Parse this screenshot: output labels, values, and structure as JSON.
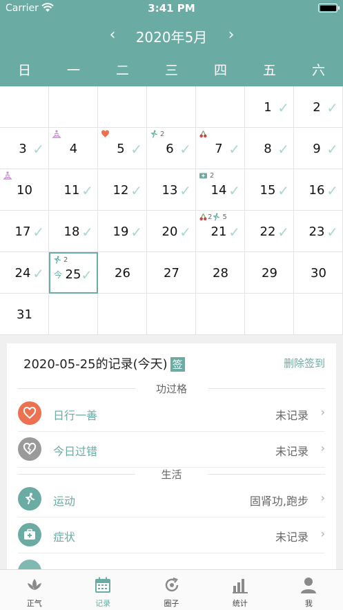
{
  "status_bar": {
    "carrier": "Carrier",
    "time": "3:41 PM"
  },
  "header": {
    "month_title": "2020年5月",
    "prev": "‹",
    "next": "›"
  },
  "weekdays": [
    "日",
    "一",
    "二",
    "三",
    "四",
    "五",
    "六"
  ],
  "calendar": {
    "days": [
      {
        "d": "1",
        "check": true
      },
      {
        "d": "2",
        "check": true
      },
      {
        "d": "3",
        "check": true
      },
      {
        "d": "4",
        "check": false,
        "icon": "meditation-icon"
      },
      {
        "d": "5",
        "check": true,
        "icon": "heart-icon"
      },
      {
        "d": "6",
        "check": true,
        "icon": "run-icon",
        "count": "2"
      },
      {
        "d": "7",
        "check": true,
        "icon": "cherry-icon"
      },
      {
        "d": "8",
        "check": true
      },
      {
        "d": "9",
        "check": true
      },
      {
        "d": "10",
        "check": false,
        "icon": "meditation-icon"
      },
      {
        "d": "11",
        "check": true
      },
      {
        "d": "12",
        "check": true
      },
      {
        "d": "13",
        "check": true
      },
      {
        "d": "14",
        "check": true,
        "icon": "medkit-icon",
        "count": "2"
      },
      {
        "d": "15",
        "check": true
      },
      {
        "d": "16",
        "check": true
      },
      {
        "d": "17",
        "check": true
      },
      {
        "d": "18",
        "check": true
      },
      {
        "d": "19",
        "check": true
      },
      {
        "d": "20",
        "check": true
      },
      {
        "d": "21",
        "check": true,
        "icon": "cherry-run-icon",
        "count": "2",
        "count2": "5"
      },
      {
        "d": "22",
        "check": true
      },
      {
        "d": "23",
        "check": true
      },
      {
        "d": "24",
        "check": true
      },
      {
        "d": "25",
        "check": true,
        "icon": "run-icon",
        "count": "2",
        "today": true,
        "today_tag": "今"
      },
      {
        "d": "26",
        "check": false
      },
      {
        "d": "27",
        "check": false
      },
      {
        "d": "28",
        "check": false
      },
      {
        "d": "29",
        "check": false
      },
      {
        "d": "30",
        "check": false
      },
      {
        "d": "31",
        "check": false
      }
    ],
    "first_weekday": 5
  },
  "panel": {
    "title": "2020-05-25的记录(今天)",
    "sign_badge": "签",
    "delete_label": "删除签到",
    "section_merit": "功过格",
    "section_life": "生活",
    "rows": [
      {
        "title": "日行一善",
        "value": "未记录",
        "color": "#ec7150"
      },
      {
        "title": "今日过错",
        "value": "未记录",
        "color": "#9a9a9a"
      },
      {
        "title": "运动",
        "value": "固肾功,跑步",
        "color": "#6aaca4"
      },
      {
        "title": "症状",
        "value": "未记录",
        "color": "#6aaca4"
      }
    ]
  },
  "tabbar": [
    {
      "label": "正气",
      "icon": "lotus-icon"
    },
    {
      "label": "记录",
      "icon": "calendar-icon",
      "active": true
    },
    {
      "label": "圈子",
      "icon": "refresh-icon"
    },
    {
      "label": "统计",
      "icon": "bar-chart-icon"
    },
    {
      "label": "我",
      "icon": "user-icon"
    }
  ],
  "colors": {
    "accent": "#6aaca4",
    "check": "#a8d7cf",
    "heart": "#ec7150"
  }
}
